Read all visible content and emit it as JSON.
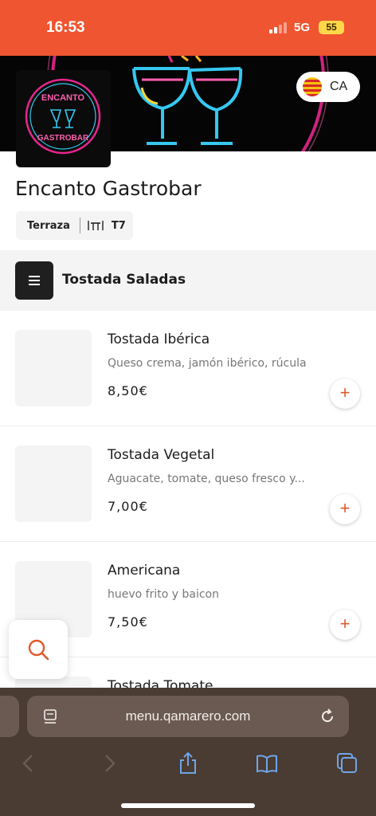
{
  "status_bar": {
    "time": "16:53",
    "network": "5G",
    "battery": "55"
  },
  "banner": {
    "language_label": "CA"
  },
  "logo": {
    "line1": "ENCANTO",
    "line2": "GASTROBAR"
  },
  "restaurant": {
    "name": "Encanto Gastrobar",
    "zone": "Terraza",
    "table": "T7"
  },
  "category": {
    "title": "Tostada Saladas"
  },
  "products": [
    {
      "name": "Tostada Ibérica",
      "description": "Queso crema, jamón ibérico, rúcula",
      "price": "8,50€",
      "add_label": "+"
    },
    {
      "name": "Tostada Vegetal",
      "description": "Aguacate, tomate, queso fresco y...",
      "price": "7,00€",
      "add_label": "+"
    },
    {
      "name": "Americana",
      "description": "huevo frito y baicon",
      "price": "7,50€",
      "add_label": "+"
    },
    {
      "name": "Tostada Tomate"
    }
  ],
  "browser": {
    "url": "menu.qamarero.com"
  },
  "colors": {
    "brand": "#ee5530",
    "accent": "#e05a2b",
    "browser_chrome": "#4a3b33",
    "toolbar_icons": "#6ea6e8"
  },
  "icons": {
    "search": "search-icon",
    "menu": "hamburger-menu-icon",
    "flag": "catalan-flag-icon",
    "table": "table-icon",
    "reader": "reader-mode-icon",
    "reload": "reload-icon",
    "back": "back-arrow-icon",
    "forward": "forward-arrow-icon",
    "share": "share-icon",
    "bookmarks": "bookmarks-icon",
    "tabs": "tabs-icon"
  }
}
